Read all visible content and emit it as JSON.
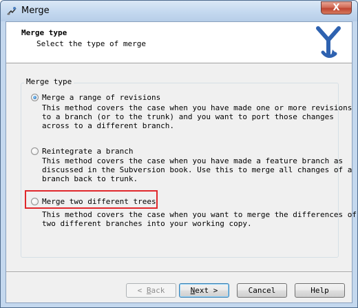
{
  "window": {
    "title": "Merge",
    "close_glyph": "X"
  },
  "header": {
    "title": "Merge type",
    "subtitle": "Select the type of merge",
    "logo_icon": "merge-tree-icon"
  },
  "group": {
    "legend": "Merge type"
  },
  "options": [
    {
      "label": "Merge a range of revisions",
      "checked": true,
      "description": "This method covers the case when you have made one or more revisions\nto a branch (or to the trunk) and you want to port those changes\nacross to a different branch."
    },
    {
      "label": "Reintegrate a branch",
      "checked": false,
      "description": "This method covers the case when you have made a feature branch as\ndiscussed in the Subversion book. Use this to merge all changes of a\nbranch back to trunk."
    },
    {
      "label": "Merge two different trees",
      "checked": false,
      "description": "This method covers the case when you want to merge the differences of\ntwo different branches into your working copy."
    }
  ],
  "buttons": {
    "back_prefix": "< ",
    "back_key": "B",
    "back_rest": "ack",
    "next_key": "N",
    "next_rest": "ext >",
    "cancel": "Cancel",
    "help": "Help"
  },
  "colors": {
    "highlight": "#e0272b",
    "accent": "#1f5fa8"
  }
}
